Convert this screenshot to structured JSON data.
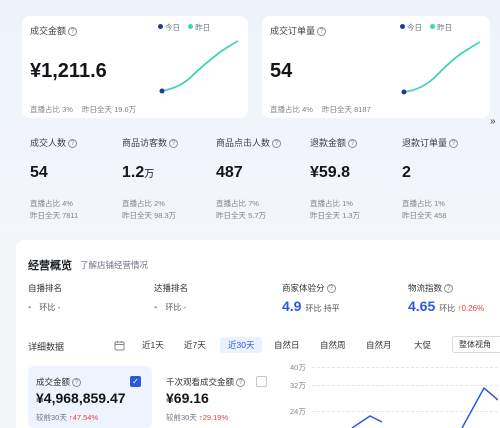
{
  "colors": {
    "accent": "#2a5bd7",
    "teal": "#3fd3b8",
    "navy": "#243a8c",
    "up": "#e8413c"
  },
  "legend": {
    "today": "今日",
    "yesterday": "昨日"
  },
  "top_cards": [
    {
      "label": "成交金额",
      "value": "¥1,211.6",
      "live_pct": "直播占比 3%",
      "yesterday_full": "昨日全天 19.6万"
    },
    {
      "label": "成交订单量",
      "value": "54",
      "live_pct": "直播占比 4%",
      "yesterday_full": "昨日全天 8187"
    }
  ],
  "small_cards": [
    {
      "label": "成交人数",
      "value": "54",
      "unit": "",
      "live_pct": "直播占比 4%",
      "yesterday_full": "昨日全天 7811"
    },
    {
      "label": "商品访客数",
      "value": "1.2",
      "unit": "万",
      "live_pct": "直播占比 2%",
      "yesterday_full": "昨日全天 98.3万"
    },
    {
      "label": "商品点击人数",
      "value": "487",
      "unit": "",
      "live_pct": "直播占比 7%",
      "yesterday_full": "昨日全天 5.7万"
    },
    {
      "label": "退款金额",
      "value": "¥59.8",
      "unit": "",
      "live_pct": "直播占比 1%",
      "yesterday_full": "昨日全天 1.3万"
    },
    {
      "label": "退款订单量",
      "value": "2",
      "unit": "",
      "live_pct": "直播占比 1%",
      "yesterday_full": "昨日全天 458"
    }
  ],
  "overview": {
    "title": "经营概览",
    "link": "了解店铺经营情况",
    "metrics": [
      {
        "label": "自播排名",
        "value": "-",
        "compare": "环比 -"
      },
      {
        "label": "达播排名",
        "value": "-",
        "compare": "环比 -"
      },
      {
        "label": "商家体验分",
        "value": "4.9",
        "compare": "环比 持平"
      },
      {
        "label": "物流指数",
        "value": "4.65",
        "compare": "环比",
        "change": "0.26%"
      }
    ]
  },
  "detail": {
    "title": "详细数据",
    "tabs": [
      "近1天",
      "近7天",
      "近30天",
      "自然日",
      "自然周",
      "自然月",
      "大促"
    ],
    "active_tab": "近30天",
    "view_select": "整体视角"
  },
  "detail_cards": [
    {
      "label": "成交金额",
      "value": "¥4,968,859.47",
      "compare": "较前30天",
      "change": "47.54%",
      "checked": true
    },
    {
      "label": "千次观看成交金额",
      "value": "¥69.16",
      "compare": "较前30天",
      "change": "29.19%",
      "checked": false
    }
  ],
  "chart_data": {
    "type": "line",
    "y_ticks": [
      "40万",
      "32万",
      "24万"
    ]
  }
}
